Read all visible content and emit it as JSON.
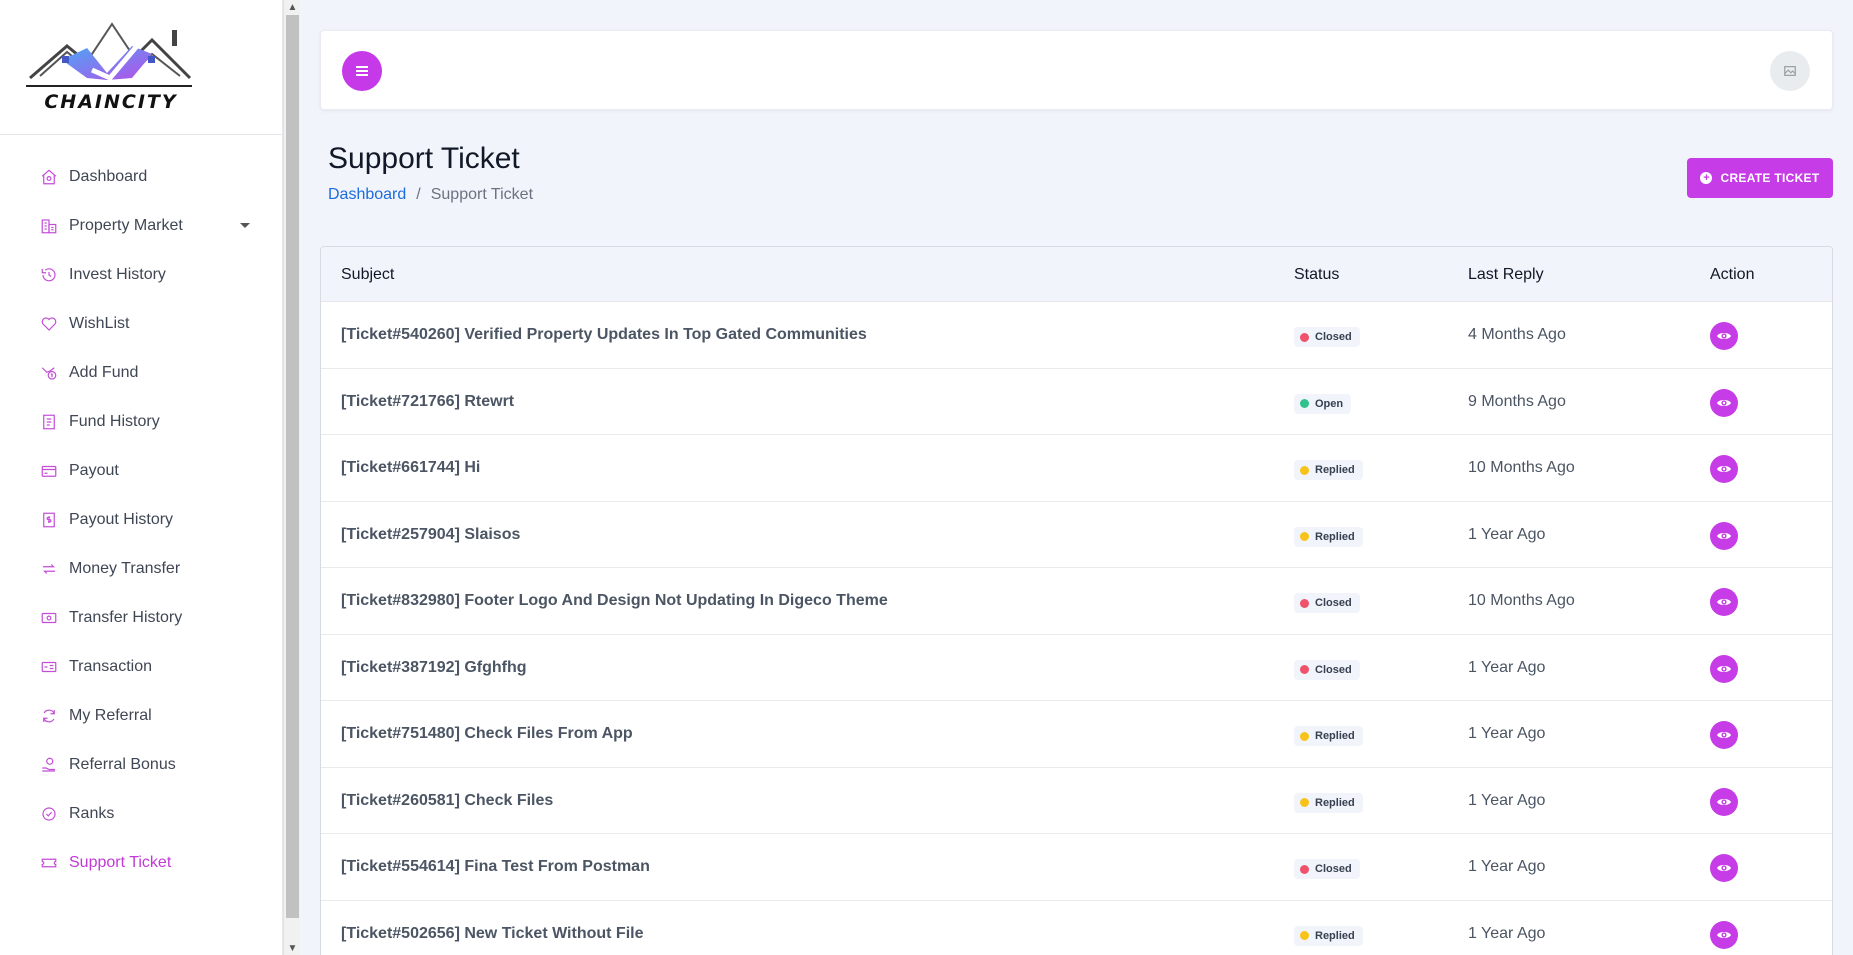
{
  "logo": {
    "text": "CHAINCITY"
  },
  "sidebar": {
    "items": [
      {
        "label": "Dashboard",
        "icon": "home-icon",
        "active": false
      },
      {
        "label": "Property Market",
        "icon": "building-icon",
        "active": false,
        "dropdown": true
      },
      {
        "label": "Invest History",
        "icon": "history-icon",
        "active": false
      },
      {
        "label": "WishList",
        "icon": "heart-icon",
        "active": false
      },
      {
        "label": "Add Fund",
        "icon": "add-fund-icon",
        "active": false
      },
      {
        "label": "Fund History",
        "icon": "receipt-icon",
        "active": false
      },
      {
        "label": "Payout",
        "icon": "credit-card-icon",
        "active": false
      },
      {
        "label": "Payout History",
        "icon": "dollar-file-icon",
        "active": false
      },
      {
        "label": "Money Transfer",
        "icon": "transfer-icon",
        "active": false
      },
      {
        "label": " Transfer History",
        "icon": "money-bill-icon",
        "active": false
      },
      {
        "label": "Transaction",
        "icon": "transaction-icon",
        "active": false
      },
      {
        "label": "My Referral",
        "icon": "refresh-icon",
        "active": false
      },
      {
        "label": "Referral Bonus",
        "icon": "hand-coin-icon",
        "active": false
      },
      {
        "label": "Ranks",
        "icon": "badge-check-icon",
        "active": false
      },
      {
        "label": "Support Ticket",
        "icon": "ticket-icon",
        "active": true
      }
    ]
  },
  "header": {
    "title": "Support Ticket",
    "breadcrumb": {
      "home": "Dashboard",
      "separator": "/",
      "current": "Support Ticket"
    },
    "create_button": "CREATE TICKET"
  },
  "table": {
    "columns": {
      "subject": "Subject",
      "status": "Status",
      "last_reply": "Last Reply",
      "action": "Action"
    },
    "rows": [
      {
        "subject": "[Ticket#540260] Verified Property Updates In Top Gated Communities",
        "status": "Closed",
        "last_reply": "4 Months Ago"
      },
      {
        "subject": "[Ticket#721766] Rtewrt",
        "status": "Open",
        "last_reply": "9 Months Ago"
      },
      {
        "subject": "[Ticket#661744] Hi",
        "status": "Replied",
        "last_reply": "10 Months Ago"
      },
      {
        "subject": "[Ticket#257904] Slaisos",
        "status": "Replied",
        "last_reply": "1 Year Ago"
      },
      {
        "subject": "[Ticket#832980] Footer Logo And Design Not Updating In Digeco Theme",
        "status": "Closed",
        "last_reply": "10 Months Ago"
      },
      {
        "subject": "[Ticket#387192] Gfghfhg",
        "status": "Closed",
        "last_reply": "1 Year Ago"
      },
      {
        "subject": "[Ticket#751480] Check Files From App",
        "status": "Replied",
        "last_reply": "1 Year Ago"
      },
      {
        "subject": "[Ticket#260581] Check Files",
        "status": "Replied",
        "last_reply": "1 Year Ago"
      },
      {
        "subject": "[Ticket#554614] Fina Test From Postman",
        "status": "Closed",
        "last_reply": "1 Year Ago"
      },
      {
        "subject": "[Ticket#502656] New Ticket Without File",
        "status": "Replied",
        "last_reply": "1 Year Ago"
      }
    ]
  },
  "colors": {
    "accent": "#c63ce6",
    "status_closed": "#f0526b",
    "status_open": "#2fc28b",
    "status_replied": "#f7c31a",
    "link": "#1d6bdc"
  }
}
